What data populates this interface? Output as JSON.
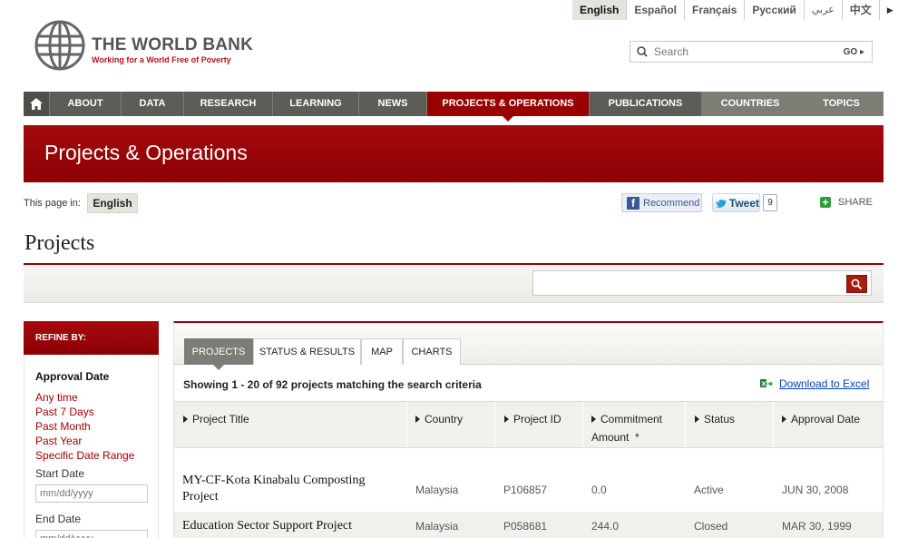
{
  "languages": [
    {
      "label": "English",
      "active": true
    },
    {
      "label": "Español"
    },
    {
      "label": "Français"
    },
    {
      "label": "Русский"
    },
    {
      "label": "عربي"
    },
    {
      "label": "中文"
    }
  ],
  "logo": {
    "title": "THE WORLD BANK",
    "tagline": "Working for a World Free of Poverty"
  },
  "top_search": {
    "placeholder": "Search",
    "go_label": "GO"
  },
  "nav": {
    "items": [
      "ABOUT",
      "DATA",
      "RESEARCH",
      "LEARNING",
      "NEWS",
      "PROJECTS & OPERATIONS",
      "PUBLICATIONS",
      "COUNTRIES",
      "TOPICS"
    ]
  },
  "banner": {
    "title": "Projects & Operations"
  },
  "page_in": {
    "label": "This page in:",
    "language": "English"
  },
  "social": {
    "recommend": "Recommend",
    "tweet": "Tweet",
    "tweet_count": "9",
    "share": "SHARE"
  },
  "projects": {
    "heading": "Projects"
  },
  "refine": {
    "heading": "REFINE BY:",
    "section_title": "Approval Date",
    "links": [
      "Any time",
      "Past 7 Days",
      "Past Month",
      "Past Year",
      "Specific Date Range"
    ],
    "start_label": "Start Date",
    "start_placeholder": "mm/dd/yyyy",
    "end_label": "End Date",
    "end_placeholder": "mm/dd/yyyy"
  },
  "tabs": [
    "PROJECTS",
    "STATUS & RESULTS",
    "MAP",
    "CHARTS"
  ],
  "results": {
    "showing": "Showing 1 - 20 of 92 projects matching the search criteria",
    "download": "Download to Excel"
  },
  "table": {
    "headers": [
      "Project Title",
      "Country",
      "Project ID",
      "Commitment Amount  *",
      "Status",
      "Approval Date"
    ],
    "rows": [
      {
        "title": "MY-CF-Kota Kinabalu Composting Project",
        "country": "Malaysia",
        "id": "P106857",
        "amount": "0.0",
        "status": "Active",
        "date": "JUN 30, 2008"
      },
      {
        "title": "Education Sector Support Project",
        "country": "Malaysia",
        "id": "P058681",
        "amount": "244.0",
        "status": "Closed",
        "date": "MAR 30, 1999"
      }
    ]
  },
  "colors": {
    "brand_red": "#990000",
    "nav_gray": "#5d5d57",
    "link_red": "#a00000"
  }
}
